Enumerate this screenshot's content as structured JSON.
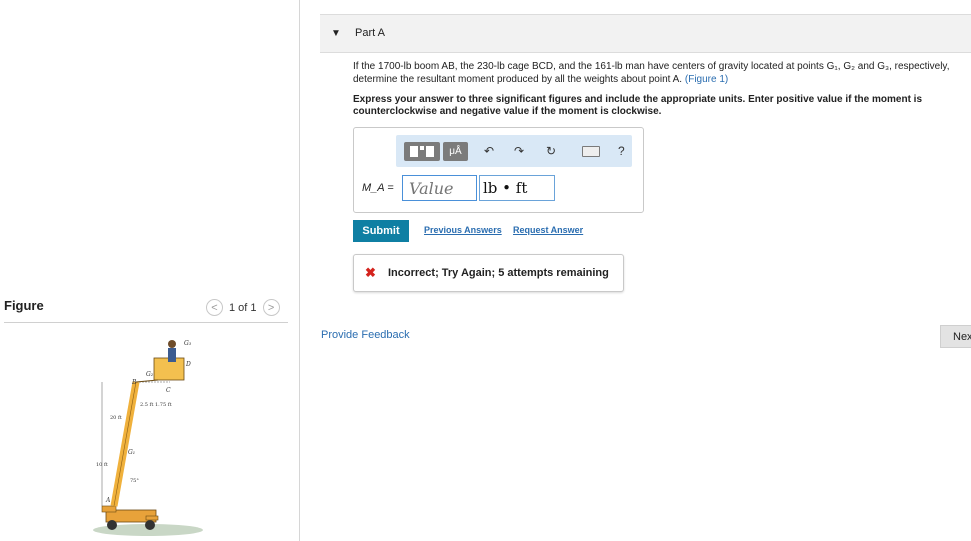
{
  "figure_panel": {
    "label": "Figure",
    "pager": "1 of 1",
    "prev_glyph": "<",
    "next_glyph": ">",
    "fig_labels": {
      "g3": "G₃",
      "d": "D",
      "g2": "G₂",
      "b": "B",
      "c": "C",
      "dims": "2.5 ft  1.75 ft",
      "twenty": "20 ft",
      "g1": "G₁",
      "ten": "10 ft",
      "angle": "75°",
      "a": "A"
    }
  },
  "part": {
    "toggle_glyph": "▼",
    "title": "Part A"
  },
  "question": {
    "text_main": "If the 1700-lb boom AB, the 230-lb cage BCD, and the 161-lb man have centers of gravity located at points G₁, G₂ and G₃, respectively, determine the resultant moment produced by all the weights about point A.",
    "figure_link": "(Figure 1)",
    "instructions": "Express your answer to three significant figures and include the appropriate units. Enter positive value if the moment is counterclockwise and negative value if the moment is clockwise."
  },
  "toolbar": {
    "mu_label": "μÅ",
    "undo_glyph": "↶",
    "redo_glyph": "↷",
    "reset_glyph": "↻",
    "help_glyph": "?"
  },
  "answer": {
    "label": "M_A =",
    "value_placeholder": "Value",
    "units": "lb • ft"
  },
  "actions": {
    "submit": "Submit",
    "previous_answers": "Previous Answers",
    "request_answer": "Request Answer"
  },
  "feedback": {
    "icon_glyph": "✖",
    "message": "Incorrect; Try Again; 5 attempts remaining"
  },
  "footer": {
    "provide_feedback": "Provide Feedback",
    "next": "Next"
  },
  "colors": {
    "submit_bg": "#0f7fa3",
    "link": "#2a6db0",
    "error": "#d4231d",
    "toolbar_bg": "#d9e8f6",
    "boom": "#f0b13c"
  }
}
